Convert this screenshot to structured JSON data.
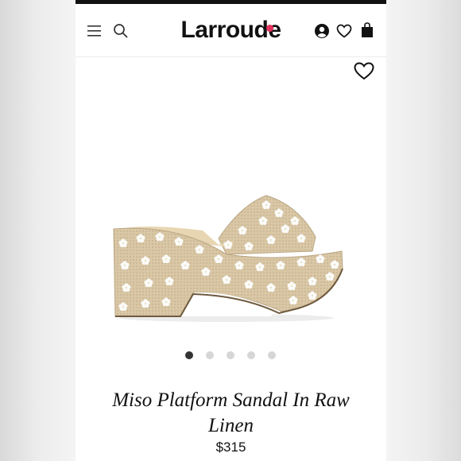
{
  "header": {
    "logo_text": "Larroude",
    "menu_icon": "hamburger-menu-icon",
    "search_icon": "search-icon",
    "account_icon": "user-account-icon",
    "wishlist_icon": "heart-icon",
    "cart_icon": "shopping-bag-icon",
    "accent_color": "#e2335c"
  },
  "product": {
    "name": "Miso Platform Sandal In Raw Linen",
    "price": "$315",
    "wishlist_icon": "heart-outline-icon",
    "image": "sandal-product-photo",
    "carousel": {
      "count": 5,
      "active": 1
    }
  }
}
